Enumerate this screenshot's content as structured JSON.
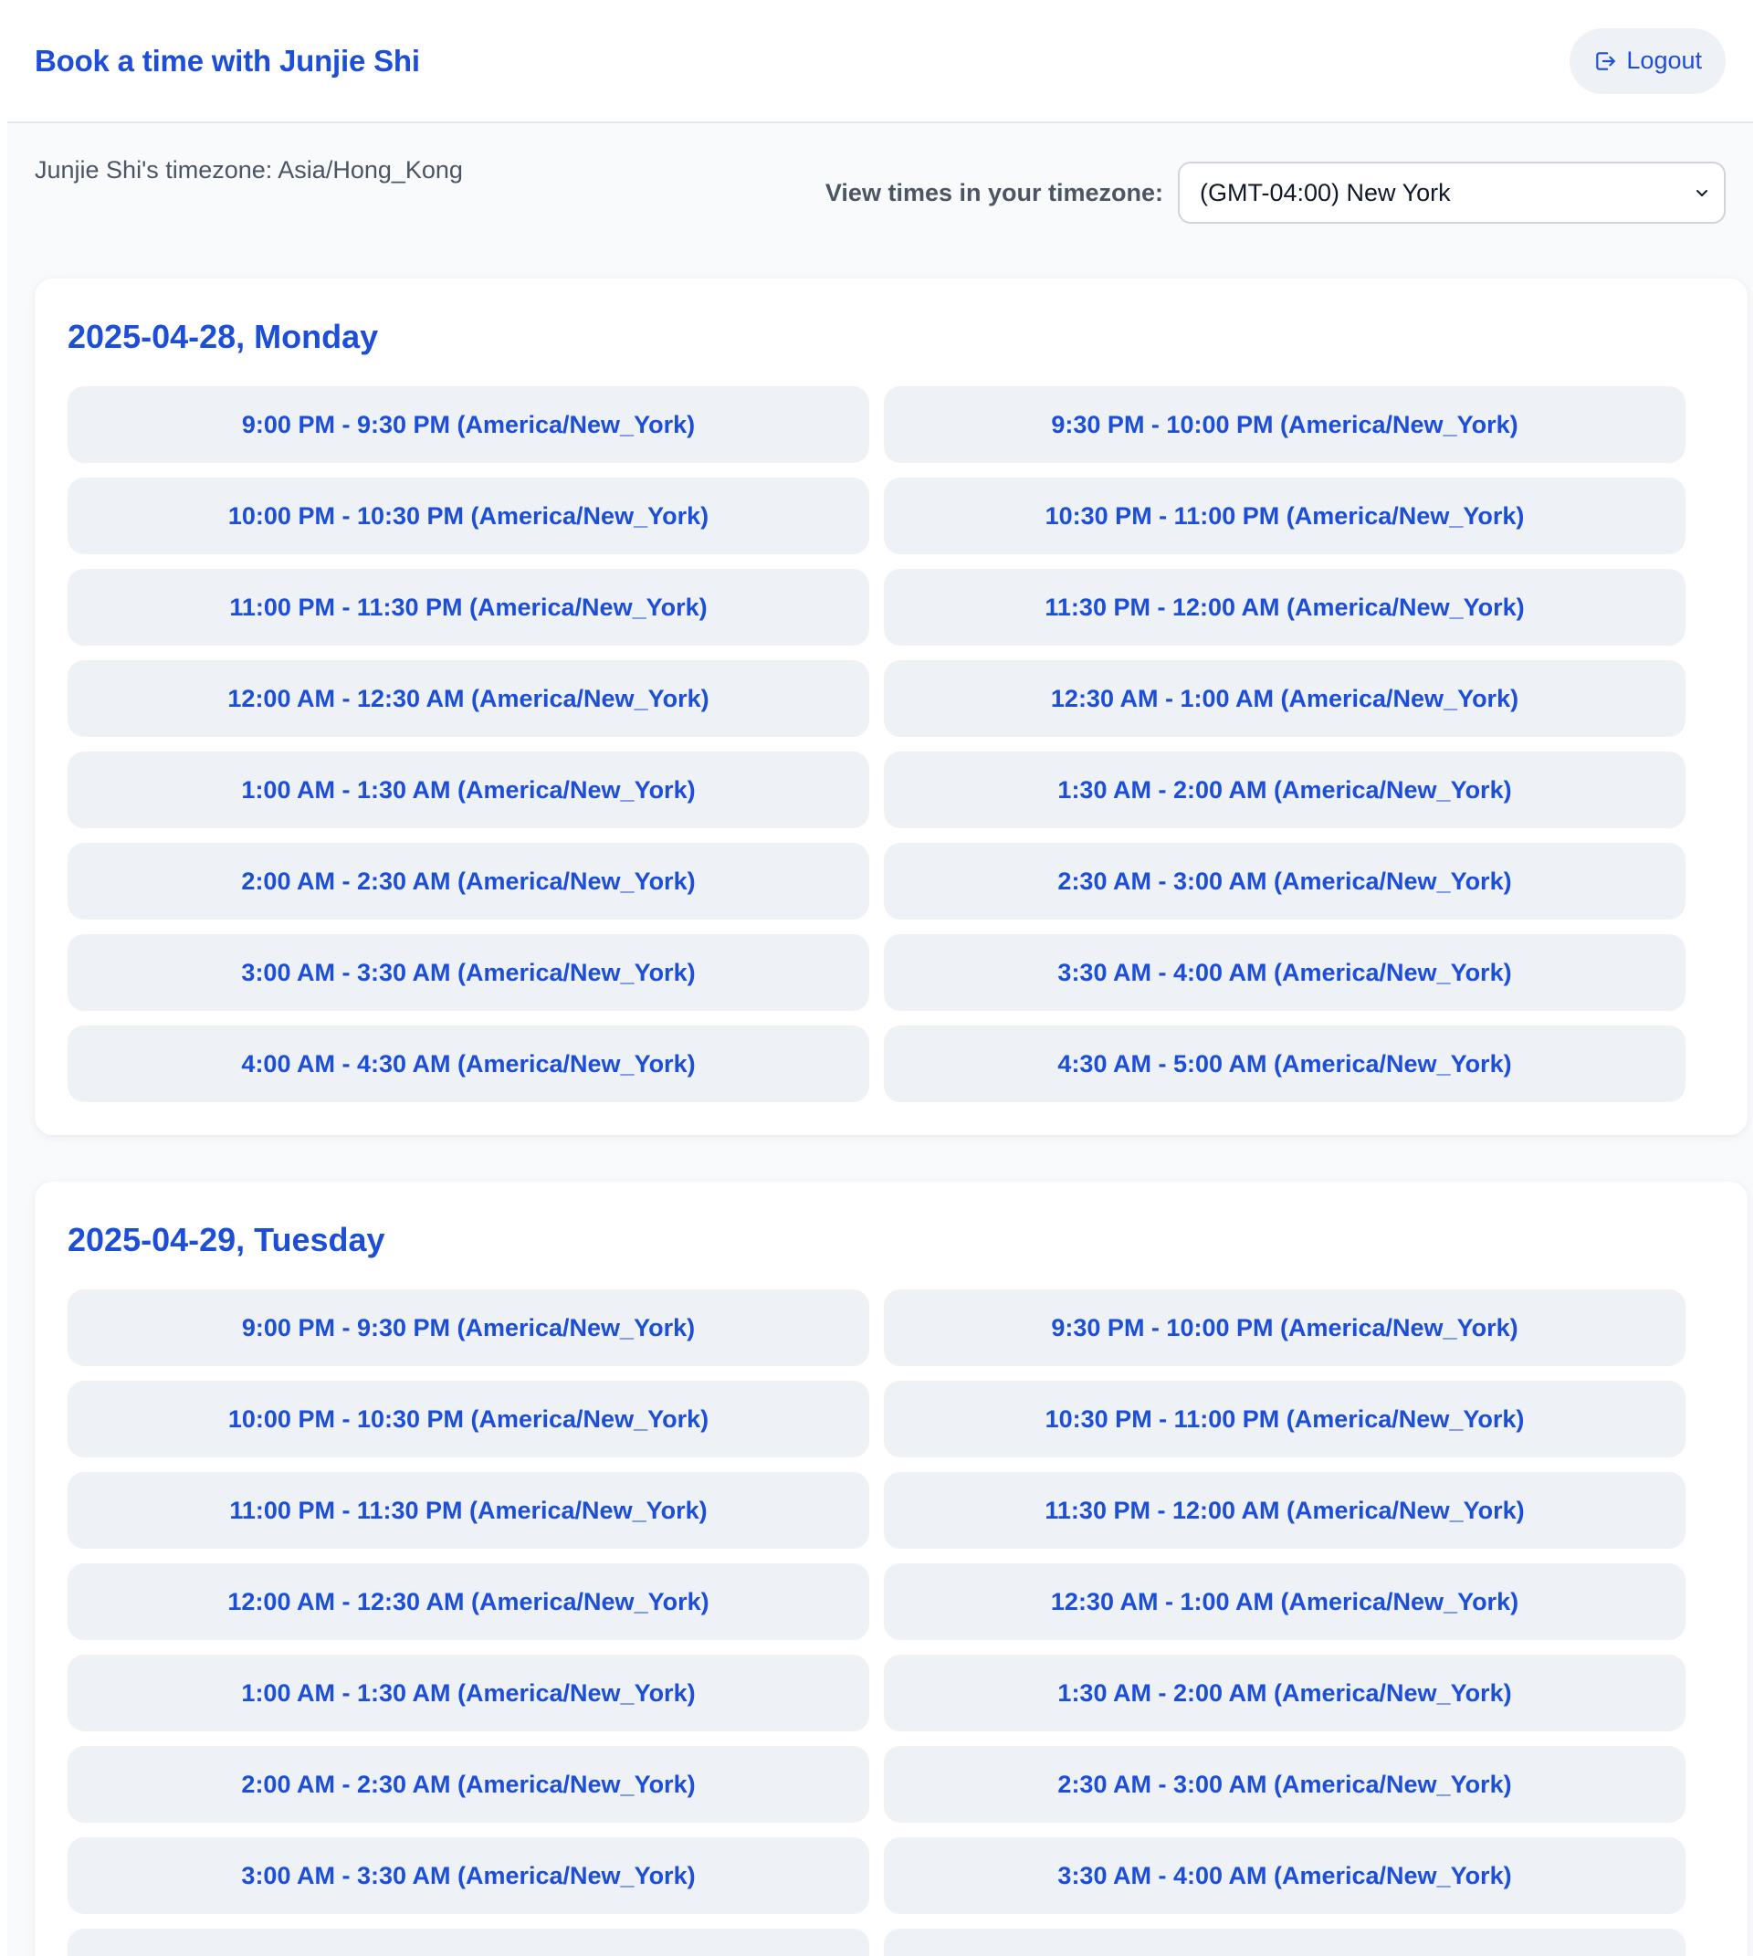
{
  "header": {
    "title": "Book a time with Junjie Shi",
    "logout_label": "Logout"
  },
  "timezone": {
    "host_label": "Junjie Shi's timezone: Asia/Hong_Kong",
    "select_label": "View times in your timezone:",
    "selected_value": "(GMT-04:00) New York"
  },
  "days": [
    {
      "title": "2025-04-28, Monday",
      "slots": [
        "9:00 PM - 9:30 PM (America/New_York)",
        "9:30 PM - 10:00 PM (America/New_York)",
        "10:00 PM - 10:30 PM (America/New_York)",
        "10:30 PM - 11:00 PM (America/New_York)",
        "11:00 PM - 11:30 PM (America/New_York)",
        "11:30 PM - 12:00 AM (America/New_York)",
        "12:00 AM - 12:30 AM (America/New_York)",
        "12:30 AM - 1:00 AM (America/New_York)",
        "1:00 AM - 1:30 AM (America/New_York)",
        "1:30 AM - 2:00 AM (America/New_York)",
        "2:00 AM - 2:30 AM (America/New_York)",
        "2:30 AM - 3:00 AM (America/New_York)",
        "3:00 AM - 3:30 AM (America/New_York)",
        "3:30 AM - 4:00 AM (America/New_York)",
        "4:00 AM - 4:30 AM (America/New_York)",
        "4:30 AM - 5:00 AM (America/New_York)"
      ]
    },
    {
      "title": "2025-04-29, Tuesday",
      "slots": [
        "9:00 PM - 9:30 PM (America/New_York)",
        "9:30 PM - 10:00 PM (America/New_York)",
        "10:00 PM - 10:30 PM (America/New_York)",
        "10:30 PM - 11:00 PM (America/New_York)",
        "11:00 PM - 11:30 PM (America/New_York)",
        "11:30 PM - 12:00 AM (America/New_York)",
        "12:00 AM - 12:30 AM (America/New_York)",
        "12:30 AM - 1:00 AM (America/New_York)",
        "1:00 AM - 1:30 AM (America/New_York)",
        "1:30 AM - 2:00 AM (America/New_York)",
        "2:00 AM - 2:30 AM (America/New_York)",
        "2:30 AM - 3:00 AM (America/New_York)",
        "3:00 AM - 3:30 AM (America/New_York)",
        "3:30 AM - 4:00 AM (America/New_York)",
        "",
        ""
      ]
    }
  ]
}
